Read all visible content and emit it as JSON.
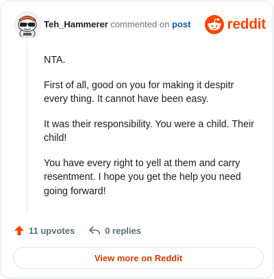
{
  "header": {
    "username": "Teh_Hammerer",
    "action_text": "commented on",
    "post_link": "post",
    "logo_text": "reddit"
  },
  "comment": {
    "paragraphs": [
      "NTA.",
      "First of all, good on you for making it despitr every thing. It cannot have been easy.",
      "It was their responsibility. You were a child. Their child!",
      "You have every right to yell at them and carry resentment. I hope you get the help you need going forward!"
    ]
  },
  "actions": {
    "upvotes": "11 upvotes",
    "replies": "0 replies"
  },
  "footer": {
    "view_more": "View more on Reddit"
  },
  "colors": {
    "brand": "#ff4500",
    "link": "#0b5cad",
    "view_more": "#d93a00"
  },
  "icons": [
    "avatar",
    "reddit-logo-icon",
    "upvote-icon",
    "reply-icon"
  ]
}
